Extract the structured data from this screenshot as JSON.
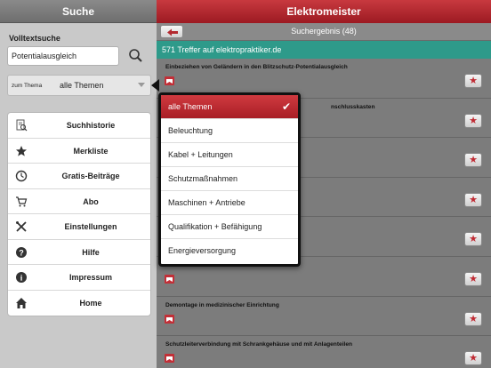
{
  "left": {
    "title": "Suche",
    "fulltext_label": "Volltextsuche",
    "search_value": "Potentialausgleich",
    "thema_label": "zum Thema",
    "thema_value": "alle Themen",
    "menu": [
      {
        "label": "Suchhistorie",
        "icon": "history-icon"
      },
      {
        "label": "Merkliste",
        "icon": "star-icon"
      },
      {
        "label": "Gratis-Beiträge",
        "icon": "clock-icon"
      },
      {
        "label": "Abo",
        "icon": "cart-icon"
      },
      {
        "label": "Einstellungen",
        "icon": "tools-icon"
      },
      {
        "label": "Hilfe",
        "icon": "help-icon"
      },
      {
        "label": "Impressum",
        "icon": "info-icon"
      },
      {
        "label": "Home",
        "icon": "home-icon"
      }
    ]
  },
  "right": {
    "title": "Elektromeister",
    "toolbar_title": "Suchergebnis (48)",
    "hits": "571 Treffer auf elektropraktiker.de",
    "results": [
      {
        "title": "Einbeziehen von Geländern in den Blitzschutz-Potentialausgleich"
      },
      {
        "title": "nschlusskasten"
      },
      {
        "title": ""
      },
      {
        "title": ""
      },
      {
        "title": ""
      },
      {
        "title": ""
      },
      {
        "title": "Demontage in medizinischer Einrichtung"
      },
      {
        "title": "Schutzleiterverbindung mit Schrankgehäuse und mit Anlagenteilen"
      }
    ]
  },
  "dropdown": {
    "options": [
      {
        "label": "alle Themen",
        "selected": true
      },
      {
        "label": "Beleuchtung",
        "selected": false
      },
      {
        "label": "Kabel + Leitungen",
        "selected": false
      },
      {
        "label": "Schutzmaßnahmen",
        "selected": false
      },
      {
        "label": "Maschinen + Antriebe",
        "selected": false
      },
      {
        "label": "Qualifikation + Befähigung",
        "selected": false
      },
      {
        "label": "Energieversorgung",
        "selected": false
      }
    ]
  },
  "colors": {
    "accent_red": "#b32a30",
    "teal": "#2e9a8a"
  }
}
